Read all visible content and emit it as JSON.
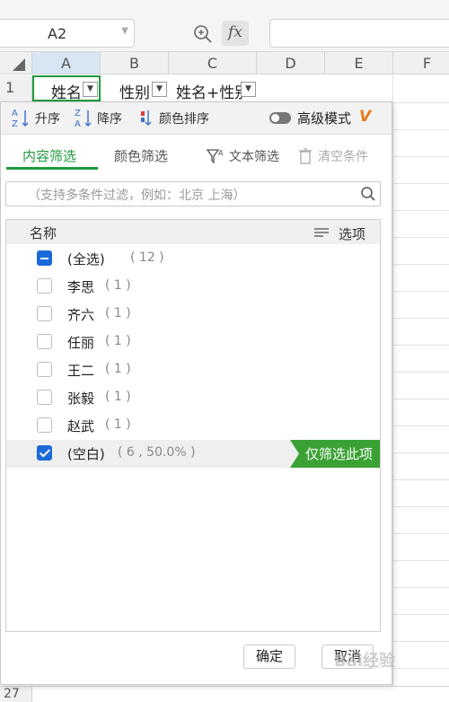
{
  "toolbar": {
    "name_box": "A2",
    "fx_label": "fx"
  },
  "grid": {
    "columns": [
      "A",
      "B",
      "C",
      "D",
      "E",
      "F"
    ],
    "row1_number": "1",
    "bottom_row_number": "27",
    "headers": [
      "姓名",
      "性别",
      "姓名+性别"
    ]
  },
  "filter_panel": {
    "sort_asc": "升序",
    "sort_desc": "降序",
    "sort_color": "颜色排序",
    "advanced_mode": "高级模式",
    "tabs": {
      "content": "内容筛选",
      "color": "颜色筛选",
      "text": "文本筛选",
      "clear": "清空条件"
    },
    "search_placeholder": "（支持多条件过滤，例如：北京  上海）",
    "list_header": {
      "name": "名称",
      "options": "选项"
    },
    "items": [
      {
        "label": "(全选)",
        "count": "( 12 )",
        "state": "partial"
      },
      {
        "label": "李思",
        "count": "( 1 )",
        "state": "unchecked"
      },
      {
        "label": "齐六",
        "count": "( 1 )",
        "state": "unchecked"
      },
      {
        "label": "任丽",
        "count": "( 1 )",
        "state": "unchecked"
      },
      {
        "label": "王二",
        "count": "( 1 )",
        "state": "unchecked"
      },
      {
        "label": "张毅",
        "count": "( 1 )",
        "state": "unchecked"
      },
      {
        "label": "赵武",
        "count": "( 1 )",
        "state": "unchecked"
      },
      {
        "label": "(空白)",
        "count": "( 6 , 50.0% )",
        "state": "checked"
      }
    ],
    "only_filter_label": "仅筛选此项",
    "ok_label": "确定",
    "cancel_label": "取消"
  },
  "watermark": "Bai经验",
  "colors": {
    "accent_green": "#1e9b3d",
    "checkbox_blue": "#1b6ad9",
    "only_button_green": "#3aa234",
    "vip_orange": "#e8791a"
  }
}
